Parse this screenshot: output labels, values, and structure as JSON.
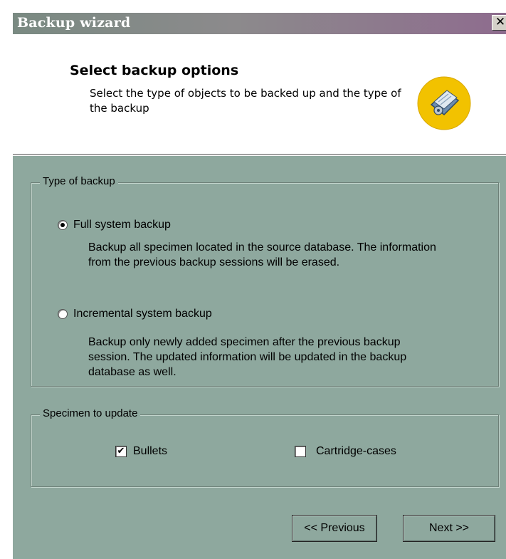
{
  "window": {
    "title": "Backup wizard",
    "close_glyph": "✕"
  },
  "header": {
    "title": "Select backup options",
    "description": "Select the type of objects to be backed up and the type of the backup",
    "icon": "backup-disk-icon"
  },
  "backup_type": {
    "legend": "Type of backup",
    "options": [
      {
        "label": "Full system backup",
        "description": "Backup all specimen located in the source database. The information from the previous backup sessions will be erased.",
        "selected": true
      },
      {
        "label": "Incremental system backup",
        "description": "Backup only newly added specimen after the previous backup session. The updated information will be updated in the backup database as well.",
        "selected": false
      }
    ]
  },
  "specimen": {
    "legend": "Specimen to update",
    "options": [
      {
        "label": "Bullets",
        "checked": true,
        "mark": "✔"
      },
      {
        "label": "Cartridge-cases",
        "checked": false,
        "mark": ""
      }
    ]
  },
  "buttons": {
    "previous": "<< Previous",
    "next": "Next >>"
  },
  "colors": {
    "window_bg": "#8ea89e",
    "icon_yellow": "#f2c200"
  }
}
